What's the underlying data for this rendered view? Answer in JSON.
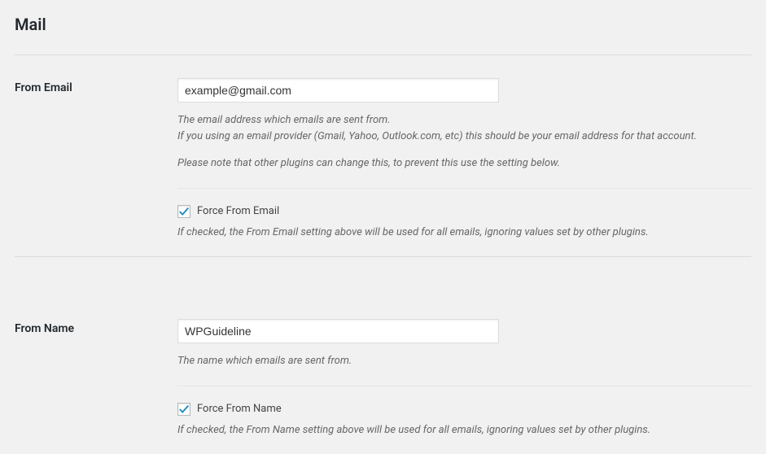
{
  "section_title": "Mail",
  "from_email": {
    "label": "From Email",
    "value": "example@gmail.com",
    "desc_line1": "The email address which emails are sent from.",
    "desc_line2": "If you using an email provider (Gmail, Yahoo, Outlook.com, etc) this should be your email address for that account.",
    "desc_line3": "Please note that other plugins can change this, to prevent this use the setting below.",
    "force_label": "Force From Email",
    "force_checked": true,
    "force_desc": "If checked, the From Email setting above will be used for all emails, ignoring values set by other plugins."
  },
  "from_name": {
    "label": "From Name",
    "value": "WPGuideline",
    "desc": "The name which emails are sent from.",
    "force_label": "Force From Name",
    "force_checked": true,
    "force_desc": "If checked, the From Name setting above will be used for all emails, ignoring values set by other plugins."
  }
}
